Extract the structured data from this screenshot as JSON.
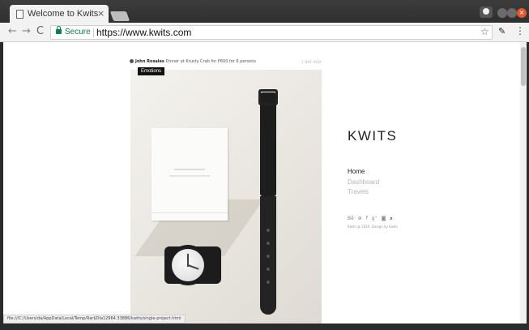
{
  "tab": {
    "title": "Welcome to Kwits",
    "close": "×"
  },
  "toolbar": {
    "back": "←",
    "forward": "→",
    "reload": "C",
    "secure_label": "Secure",
    "url": "https://www.kwits.com",
    "star": "☆",
    "menu": "⋮"
  },
  "post": {
    "author": "John Rosales",
    "title": "Dinner at Krusty Crab for P600 for 6 persons",
    "date": "1 DAY AGO",
    "tag": "Emotions"
  },
  "site": {
    "brand": "KWITS",
    "nav": [
      {
        "label": "Home",
        "active": true
      },
      {
        "label": "Dashboard",
        "active": false
      },
      {
        "label": "Travels",
        "active": false
      }
    ],
    "social_icons": [
      "behance-icon",
      "dribbble-icon",
      "facebook-icon",
      "google-plus-icon",
      "instagram-icon",
      "search-icon"
    ],
    "social_glyphs": {
      "behance": "Bē",
      "dribbble": "⊛",
      "facebook": "f",
      "google_plus": "g⁺",
      "instagram": "◙",
      "search": "⌕"
    },
    "copyright": "Kwits @ 2016. Design by Kwits"
  },
  "status_url": "file:///C:/Users/da/AppData/Local/Temp/Rar$DIa12964.33886/kwits/single-project.html",
  "colors": {
    "secure_green": "#0b8043",
    "close_button": "#e0582e"
  }
}
